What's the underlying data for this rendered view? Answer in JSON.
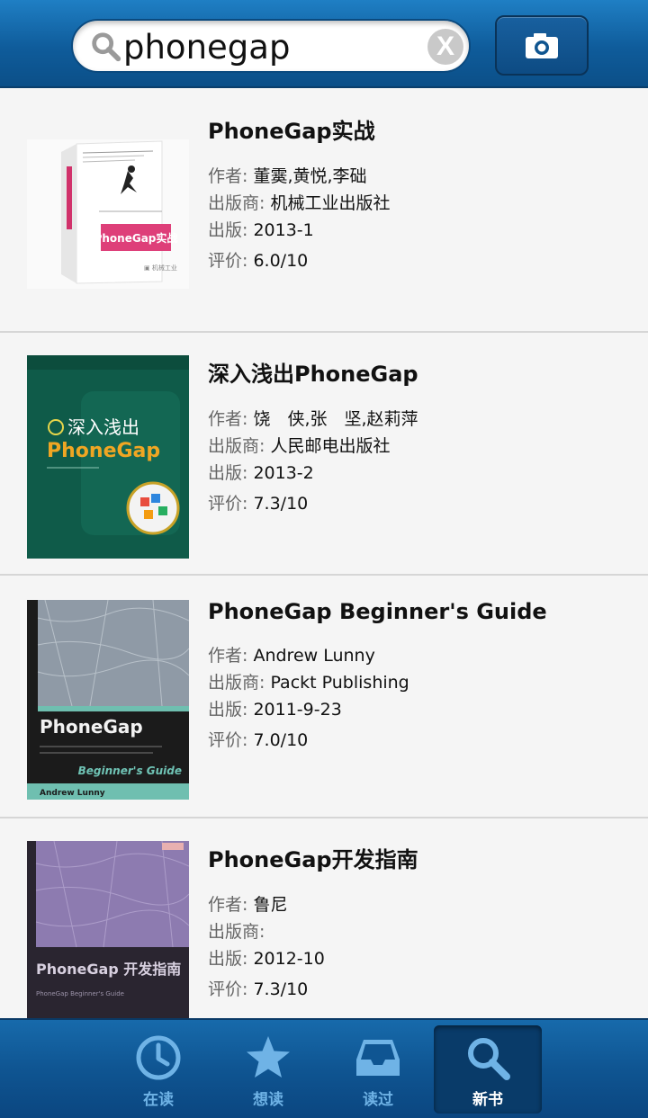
{
  "search": {
    "query": "phonegap",
    "clear_label": "X"
  },
  "books": [
    {
      "title": "PhoneGap实战",
      "author_label": "作者:",
      "author": "董霙,黄悦,李础",
      "publisher_label": "出版商:",
      "publisher": "机械工业出版社",
      "date_label": "出版:",
      "date": "2013-1",
      "rating_label": "评价:",
      "rating": "6.0/10",
      "cover_text": "PhoneGap实战"
    },
    {
      "title": "深入浅出PhoneGap",
      "author_label": "作者:",
      "author": "饶　侠,张　坚,赵莉萍",
      "publisher_label": "出版商:",
      "publisher": "人民邮电出版社",
      "date_label": "出版:",
      "date": "2013-2",
      "rating_label": "评价:",
      "rating": "7.3/10",
      "cover_text": "深入浅出",
      "cover_text2": "PhoneGap"
    },
    {
      "title": "PhoneGap Beginner's Guide",
      "author_label": "作者:",
      "author": "Andrew Lunny",
      "publisher_label": "出版商:",
      "publisher": "Packt Publishing",
      "date_label": "出版:",
      "date": "2011-9-23",
      "rating_label": "评价:",
      "rating": "7.0/10",
      "cover_text": "PhoneGap",
      "cover_text2": "Beginner's Guide",
      "cover_text3": "Andrew Lunny"
    },
    {
      "title": "PhoneGap开发指南",
      "author_label": "作者:",
      "author": "鲁尼",
      "publisher_label": "出版商:",
      "publisher": "",
      "date_label": "出版:",
      "date": "2012-10",
      "rating_label": "评价:",
      "rating": "7.3/10",
      "cover_text": "PhoneGap 开发指南",
      "cover_text2": "PhoneGap Beginner's Guide"
    }
  ],
  "tabs": [
    {
      "label": "在读",
      "icon": "clock-icon"
    },
    {
      "label": "想读",
      "icon": "star-icon"
    },
    {
      "label": "读过",
      "icon": "inbox-icon"
    },
    {
      "label": "新书",
      "icon": "search-icon",
      "active": true
    }
  ],
  "colors": {
    "accent": "#0f5c9b",
    "tab_inactive": "#6fb3e6",
    "tab_active": "#ffffff"
  }
}
